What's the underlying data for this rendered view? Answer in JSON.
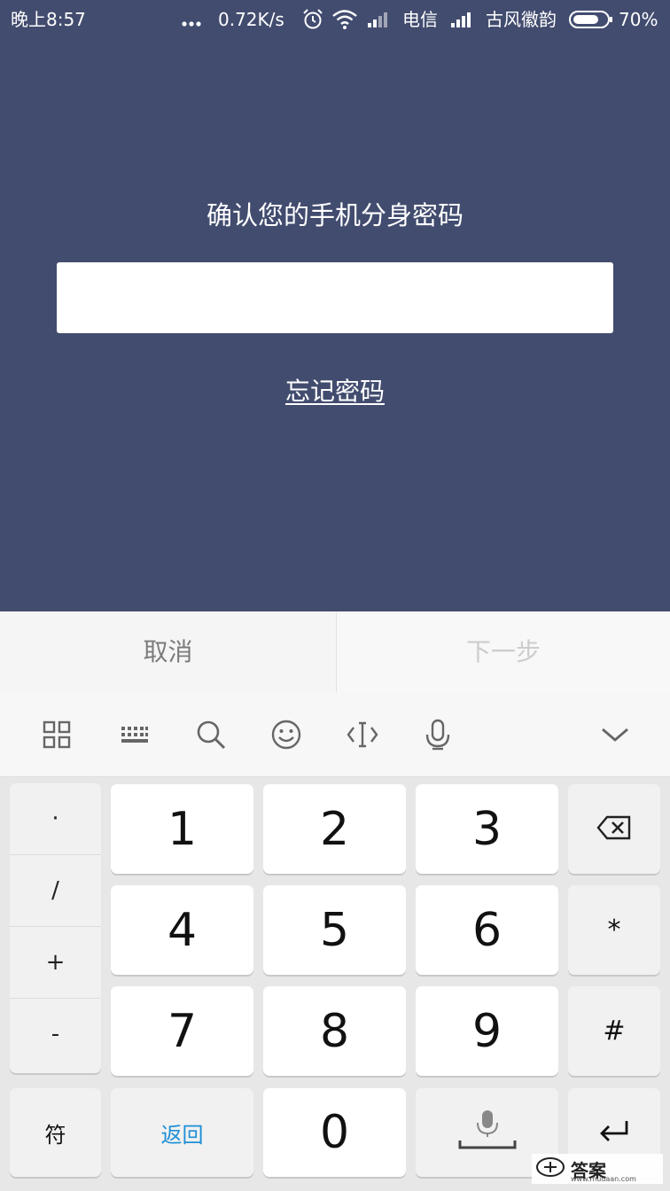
{
  "status_bar": {
    "time": "晚上8:57",
    "net_speed": "0.72K/s",
    "carrier1": "电信",
    "carrier2": "古风徽韵",
    "battery": "70%",
    "icons": [
      "more-dots-icon",
      "alarm-icon",
      "wifi-icon",
      "signal-icon",
      "signal-icon",
      "battery-icon"
    ]
  },
  "screen": {
    "prompt": "确认您的手机分身密码",
    "password_value": "",
    "password_placeholder": "",
    "forgot_link": "忘记密码",
    "background_color": "#424c6f"
  },
  "actions": {
    "cancel": "取消",
    "next": "下一步"
  },
  "keyboard": {
    "toolbar_icons": [
      "grid-icon",
      "keyboard-icon",
      "search-icon",
      "emoji-icon",
      "cursor-icon",
      "microphone-icon",
      "chevron-down-icon"
    ],
    "symbols": [
      "·",
      "/",
      "+",
      "-"
    ],
    "digits": [
      "1",
      "2",
      "3",
      "4",
      "5",
      "6",
      "7",
      "8",
      "9",
      "0"
    ],
    "star": "*",
    "hash": "#",
    "symbol_key": "符",
    "return_key": "返回",
    "return_key_color": "#1e8fd6",
    "icons": [
      "backspace-icon",
      "microphone-space-icon",
      "enter-icon"
    ]
  },
  "watermark": {
    "text": "答案",
    "url": "www.mudaan.com"
  }
}
